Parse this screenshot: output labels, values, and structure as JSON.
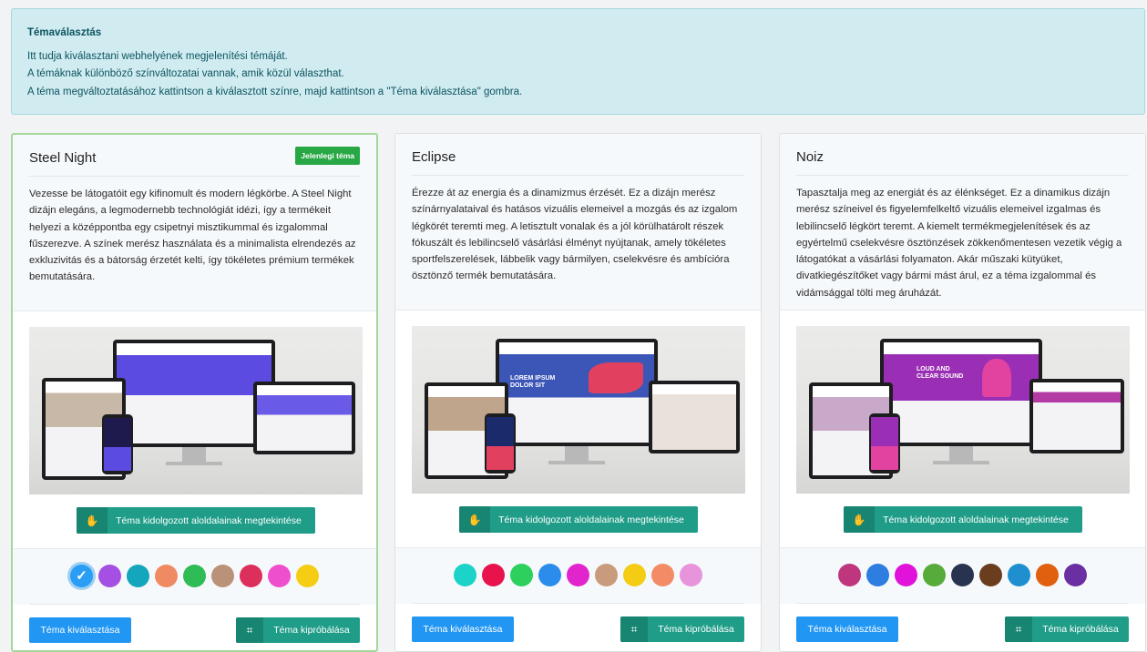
{
  "info": {
    "title": "Témaválasztás",
    "line1": "Itt tudja kiválasztani webhelyének megjelenítési témáját.",
    "line2": "A témáknak különböző színváltozatai vannak, amik közül választhat.",
    "line3": "A téma megváltoztatásához kattintson a kiválasztott színre, majd kattintson a \"Téma kiválasztása\" gombra."
  },
  "labels": {
    "current_badge": "Jelenlegi téma",
    "subpages_button": "Téma kidolgozott aloldalainak megtekintése",
    "choose_button": "Téma kiválasztása",
    "try_button": "Téma kipróbálása"
  },
  "themes": [
    {
      "name": "Steel Night",
      "current": true,
      "description": "Vezesse be látogatóit egy kifinomult és modern légkörbe. A Steel Night dizájn elegáns, a legmodernebb technológiát idézi, így a termékeit helyezi a középpontba egy csipetnyi misztikummal és izgalommal fűszerezve. A színek merész használata és a minimalista elrendezés az exkluzivitás és a bátorság érzetét kelti, így tökéletes prémium termékek bemutatására.",
      "hero_text": "",
      "colors": [
        "#2a9df4",
        "#a54fe3",
        "#14a6bd",
        "#f08a62",
        "#2fbb55",
        "#b99277",
        "#dc2f5c",
        "#ee4fcd",
        "#f5cd15"
      ],
      "selected_color": 0
    },
    {
      "name": "Eclipse",
      "current": false,
      "description": "Érezze át az energia és a dinamizmus érzését. Ez a dizájn merész színárnyalataival és hatásos vizuális elemeivel a mozgás és az izgalom légkörét teremti meg. A letisztult vonalak és a jól körülhatárolt részek fókuszált és lebilincselő vásárlási élményt nyújtanak, amely tökéletes sportfelszerelések, lábbelik vagy bármilyen, cselekvésre és ambícióra ösztönző termék bemutatására.",
      "hero_text": "LOREM IPSUM DOLOR SIT",
      "colors": [
        "#1bd3c8",
        "#e8124d",
        "#2ed05d",
        "#2b8cec",
        "#e224cc",
        "#c79b7b",
        "#f4cc14",
        "#f28b66",
        "#e794dd"
      ],
      "selected_color": -1
    },
    {
      "name": "Noiz",
      "current": false,
      "description": "Tapasztalja meg az energiát és az élénkséget. Ez a dinamikus dizájn merész színeivel és figyelemfelkeltő vizuális elemeivel izgalmas és lebilincselő légkört teremt. A kiemelt termékmegjelenítések és az egyértelmű cselekvésre ösztönzések zökkenőmentesen vezetik végig a látogatókat a vásárlási folyamaton. Akár műszaki kütyüket, divatkiegészítőket vagy bármi mást árul, ez a téma izgalommal és vidámsággal tölti meg áruházát.",
      "hero_text": "LOUD AND CLEAR SOUND",
      "colors": [
        "#c0367e",
        "#2e7de0",
        "#e112d9",
        "#56ab3a",
        "#28334f",
        "#6a3d1f",
        "#1f8fd0",
        "#e0600f",
        "#6a2fa2"
      ],
      "selected_color": -1
    }
  ],
  "preview_palette": {
    "steel_night": [
      "#5b4be0",
      "#1f1a4d"
    ],
    "eclipse": [
      "#3c56b8",
      "#e2405f"
    ],
    "noiz": [
      "#9a2fb5",
      "#e243a0"
    ]
  }
}
